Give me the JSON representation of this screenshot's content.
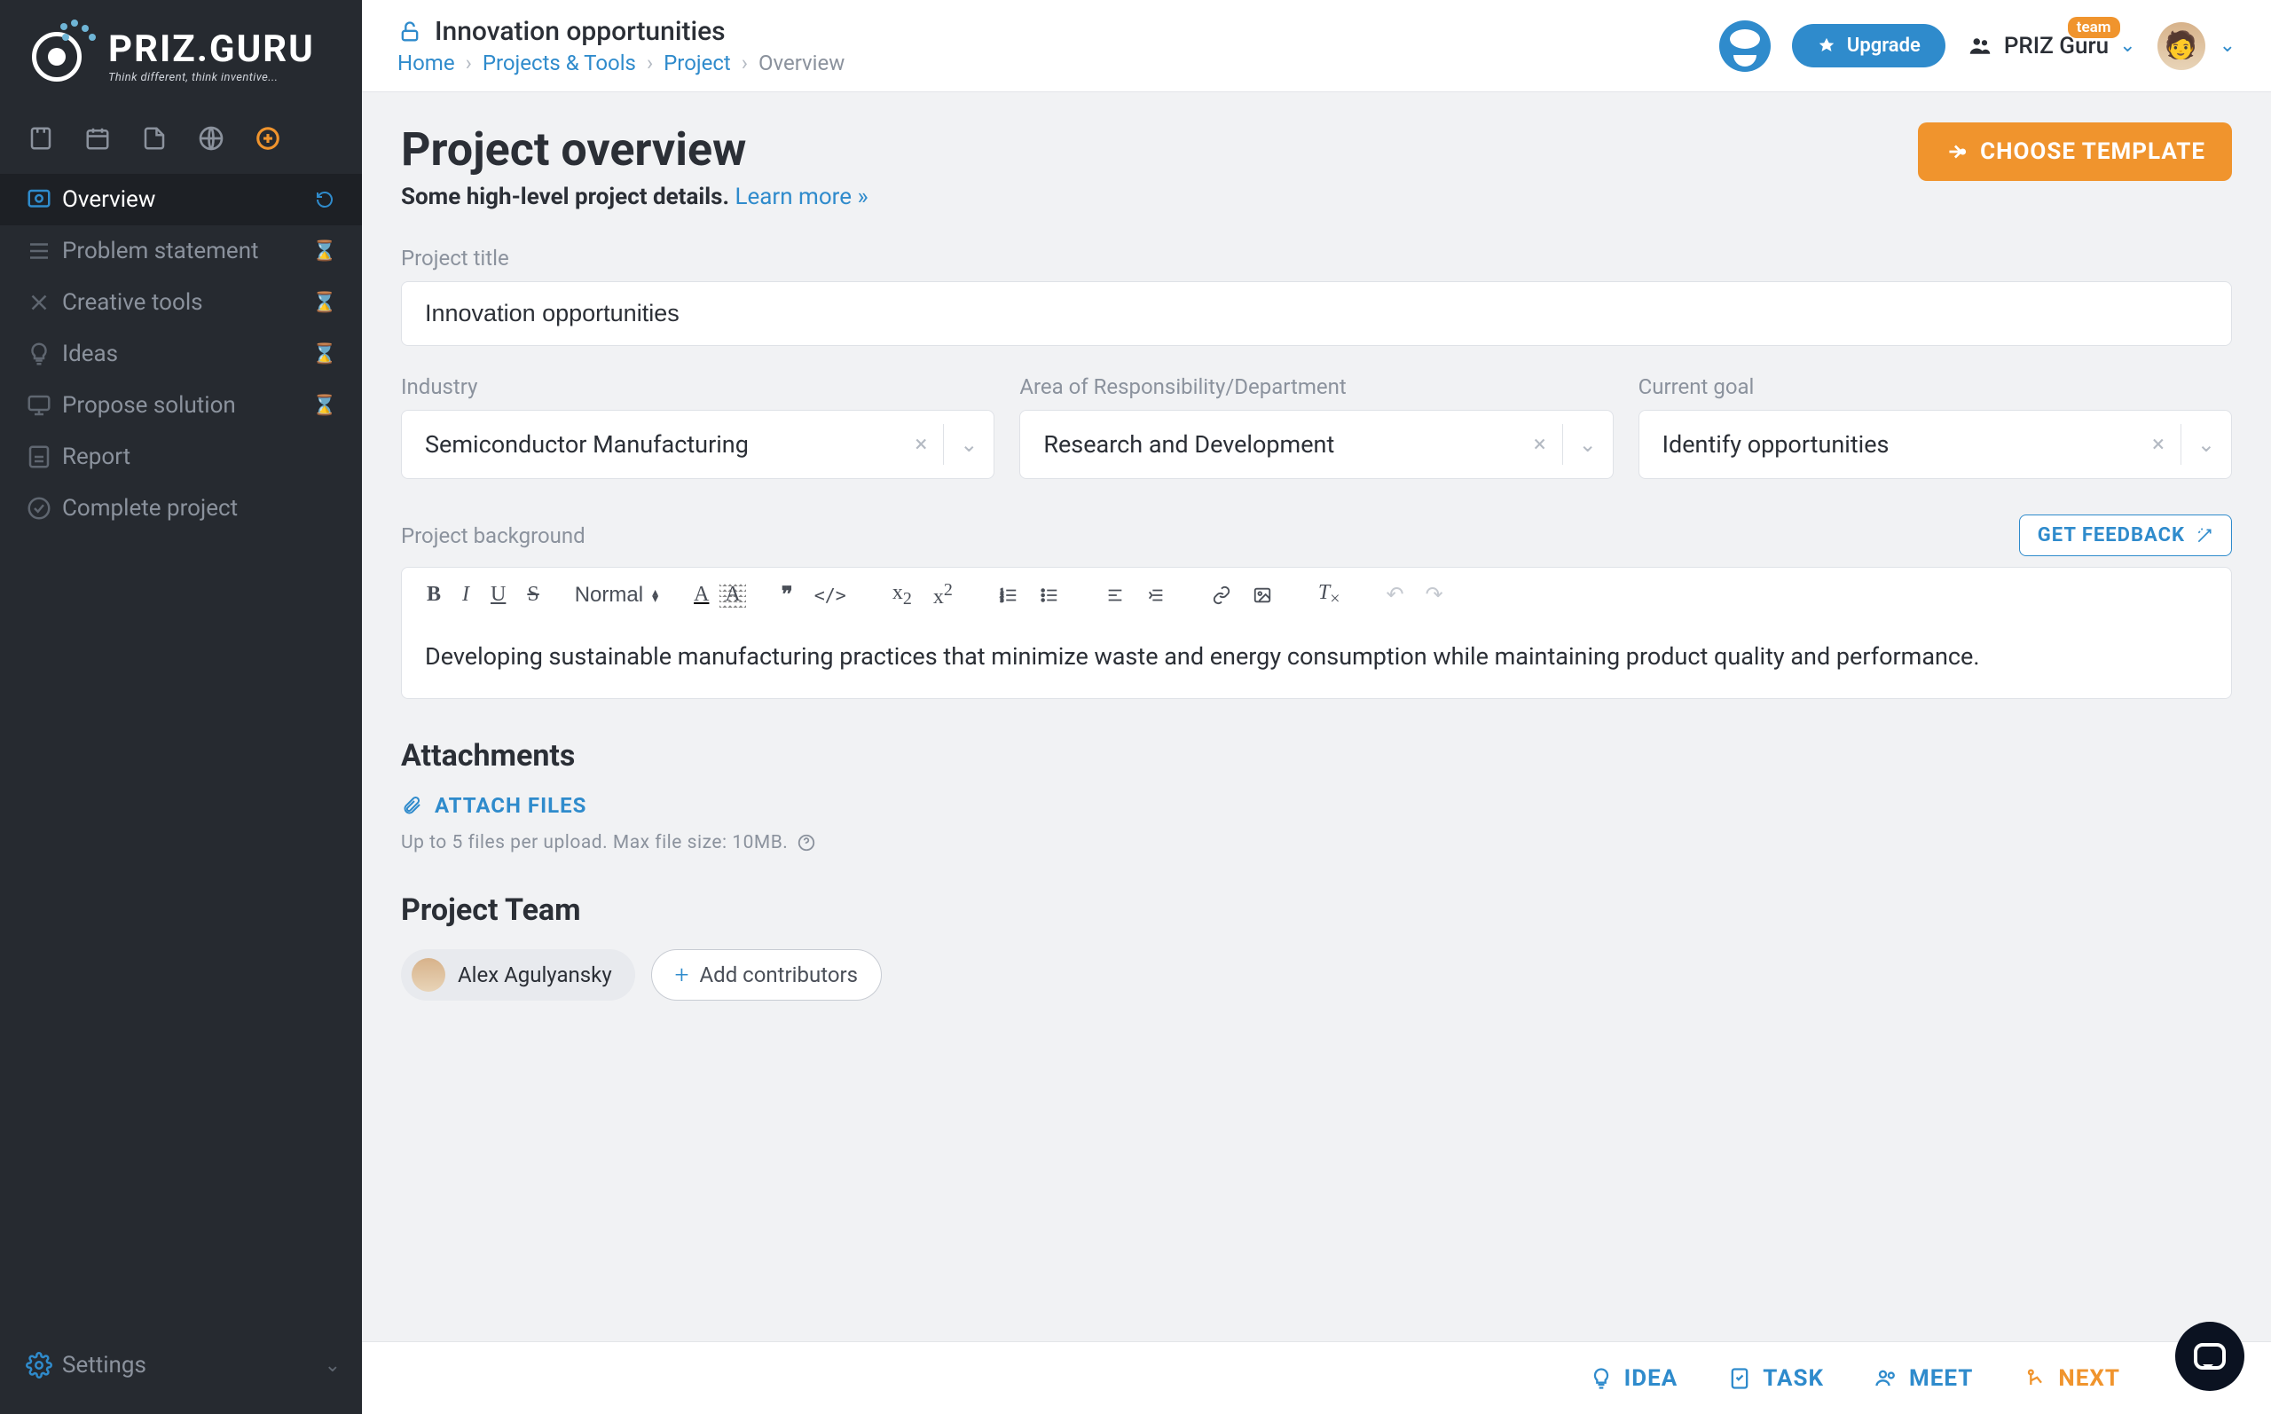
{
  "logo": {
    "word": "PRIZ.GURU",
    "tagline": "Think different, think inventive..."
  },
  "header": {
    "lock_title": "Innovation opportunities",
    "breadcrumbs": {
      "home": "Home",
      "projects_tools": "Projects & Tools",
      "project": "Project",
      "overview": "Overview"
    },
    "upgrade": "Upgrade",
    "team_name": "PRIZ Guru",
    "team_badge": "team"
  },
  "sidebar": {
    "items": [
      {
        "label": "Overview"
      },
      {
        "label": "Problem statement"
      },
      {
        "label": "Creative tools"
      },
      {
        "label": "Ideas"
      },
      {
        "label": "Propose solution"
      },
      {
        "label": "Report"
      },
      {
        "label": "Complete project"
      }
    ],
    "settings": "Settings"
  },
  "page": {
    "title": "Project overview",
    "subtitle": "Some high-level project details.",
    "learn_more": "Learn more »",
    "choose_template": "CHOOSE TEMPLATE"
  },
  "form": {
    "title_label": "Project title",
    "title_value": "Innovation opportunities",
    "industry_label": "Industry",
    "industry_value": "Semiconductor Manufacturing",
    "dept_label": "Area of Responsibility/Department",
    "dept_value": "Research and Development",
    "goal_label": "Current goal",
    "goal_value": "Identify opportunities",
    "bg_label": "Project background",
    "get_feedback": "GET FEEDBACK",
    "bg_value": "Developing sustainable manufacturing practices that minimize waste and energy consumption while maintaining product quality and performance.",
    "paragraph_style": "Normal"
  },
  "attachments": {
    "heading": "Attachments",
    "attach_files": "ATTACH FILES",
    "note": "Up to 5 files per upload. Max file size: 10MB."
  },
  "team": {
    "heading": "Project Team",
    "member": "Alex Agulyansky",
    "add": "Add contributors"
  },
  "footer": {
    "idea": "IDEA",
    "task": "TASK",
    "meet": "MEET",
    "next": "NEXT"
  }
}
